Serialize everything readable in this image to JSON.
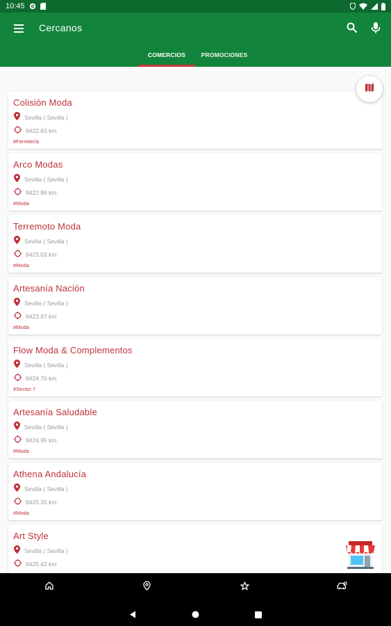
{
  "status_bar": {
    "time": "10:45"
  },
  "header": {
    "title": "Cercanos",
    "tabs": [
      {
        "label": "COMERCIOS",
        "active": true
      },
      {
        "label": "PROMOCIONES",
        "active": false
      }
    ]
  },
  "colors": {
    "primary": "#13843b",
    "status": "#0c6a2f",
    "accent": "#c0303a",
    "indicator": "#c43a3a"
  },
  "shops": [
    {
      "name": "Colisión Moda",
      "location": "Sevilla ( Sevilla )",
      "distance": "9422.63 km",
      "tag": "#Ferretería"
    },
    {
      "name": "Arco Modas",
      "location": "Sevilla ( Sevilla )",
      "distance": "9422.86 km",
      "tag": "#Moda"
    },
    {
      "name": "Terremoto Moda",
      "location": "Sevilla ( Sevilla )",
      "distance": "9423.03 km",
      "tag": "#Moda"
    },
    {
      "name": "Artesanía Nación",
      "location": "Sevilla ( Sevilla )",
      "distance": "9423.97 km",
      "tag": "#Moda"
    },
    {
      "name": "Flow Moda & Complementos",
      "location": "Sevilla ( Sevilla )",
      "distance": "9424.70 km",
      "tag": "#Sector 7"
    },
    {
      "name": "Artesanía Saludable",
      "location": "Sevilla ( Sevilla )",
      "distance": "9424.95 km",
      "tag": "#Moda"
    },
    {
      "name": "Athena Andalucía",
      "location": "Sevilla ( Sevilla )",
      "distance": "9425.30 km",
      "tag": "#Moda"
    },
    {
      "name": "Art Style",
      "location": "Sevilla ( Sevilla )",
      "distance": "9425.42 km",
      "tag": ""
    }
  ],
  "icons": {
    "menu": "hamburger-icon",
    "search": "search-icon",
    "mic": "mic-icon",
    "location": "location-pin-icon",
    "distance": "target-icon",
    "map": "map-icon",
    "store": "store-icon",
    "home": "home-icon",
    "place": "place-icon",
    "favorites": "star-icon",
    "vehicle": "car-icon"
  }
}
